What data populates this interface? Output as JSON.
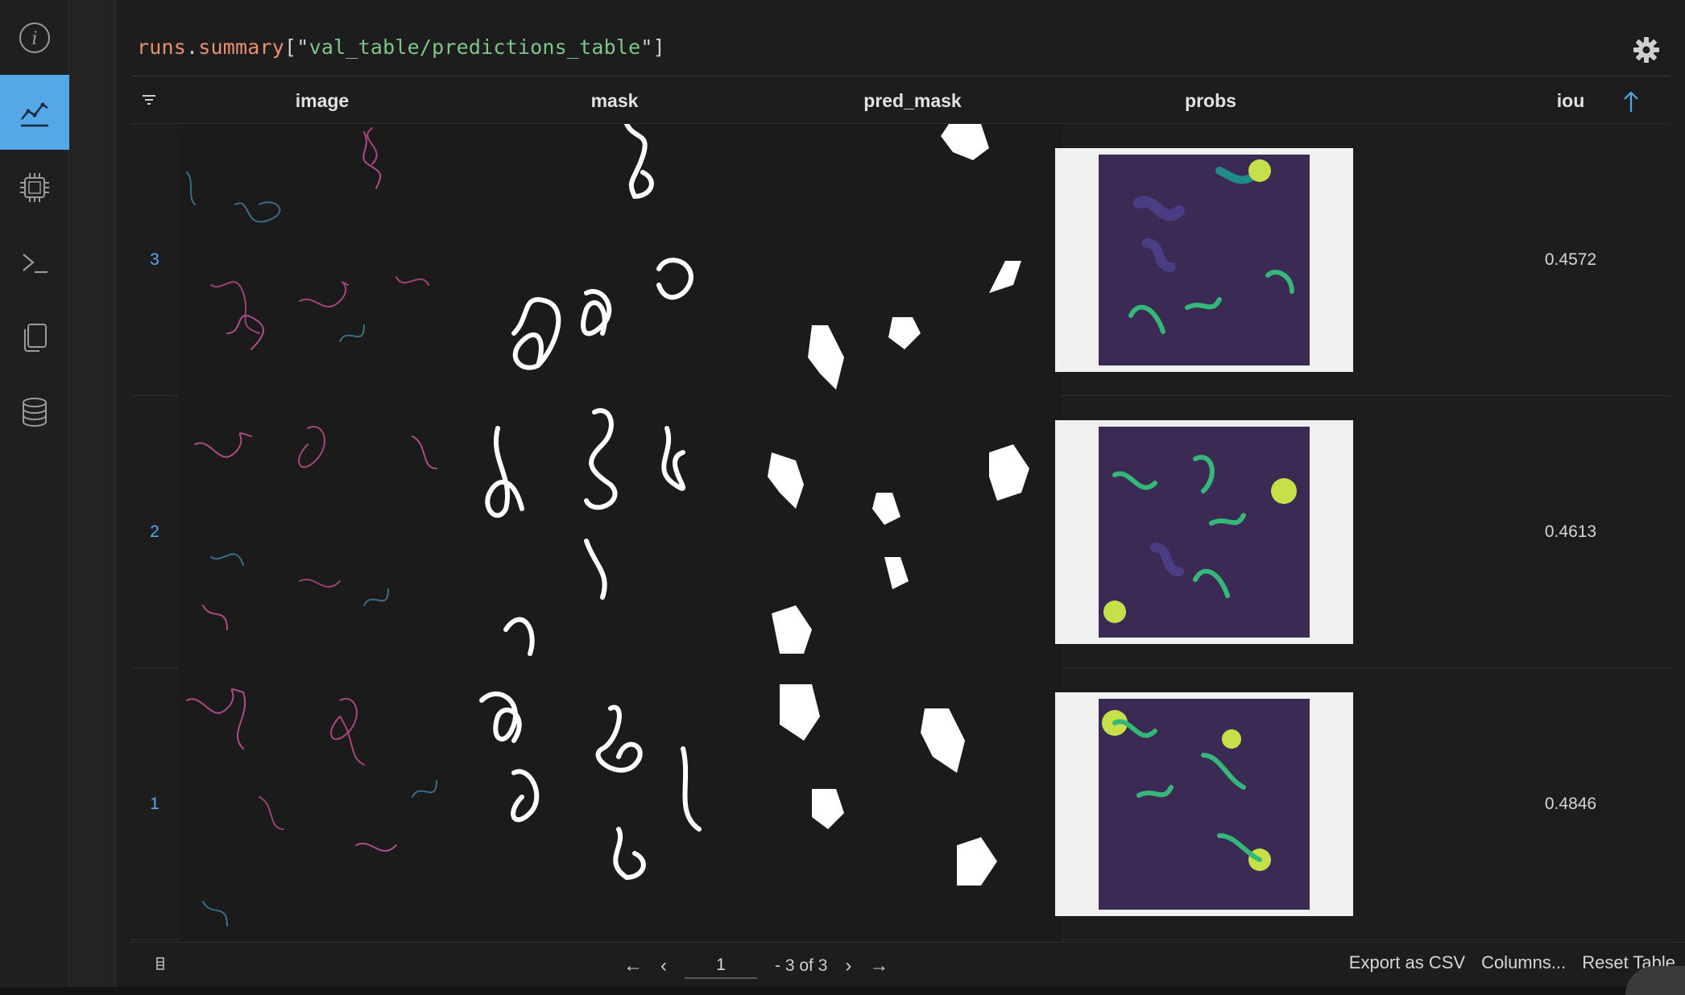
{
  "sidebar": {
    "items": [
      {
        "icon": "info-icon",
        "active": false
      },
      {
        "icon": "chart-line-icon",
        "active": true
      },
      {
        "icon": "chip-icon",
        "active": false
      },
      {
        "icon": "terminal-icon",
        "active": false
      },
      {
        "icon": "files-icon",
        "active": false
      },
      {
        "icon": "database-icon",
        "active": false
      }
    ],
    "accent_color": "#55a8e8"
  },
  "query": {
    "var": "runs",
    "dot": ".",
    "prop": "summary",
    "open": "[\"",
    "key": "val_table/predictions_table",
    "close": "\"]"
  },
  "table": {
    "columns": [
      "image",
      "mask",
      "pred_mask",
      "probs",
      "iou"
    ],
    "rows": [
      {
        "index": "3",
        "iou": "0.4572"
      },
      {
        "index": "2",
        "iou": "0.4613"
      },
      {
        "index": "1",
        "iou": "0.4846"
      }
    ]
  },
  "footer": {
    "prev_first": "←",
    "prev": "‹",
    "page": "1",
    "range": "- 3 of 3",
    "next": "›",
    "next_last": "→",
    "export": "Export as CSV",
    "columns": "Columns...",
    "reset": "Reset Table"
  }
}
